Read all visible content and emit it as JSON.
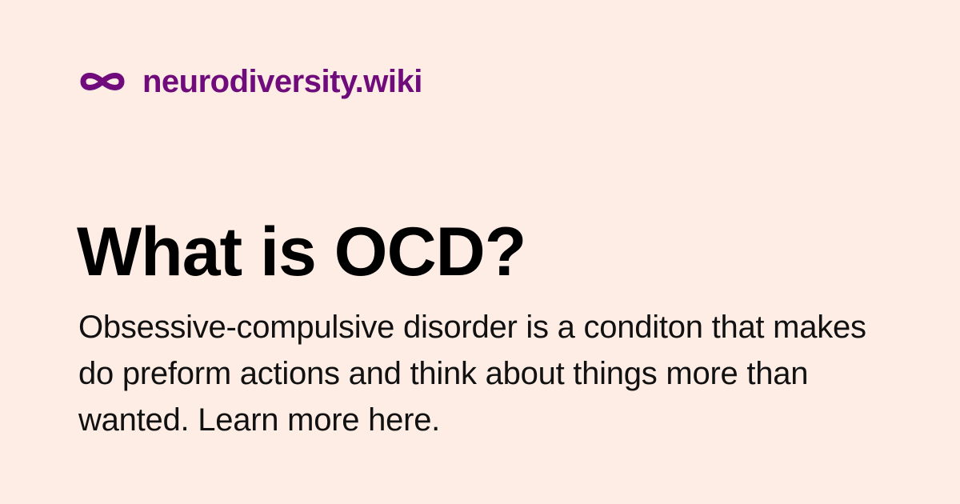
{
  "brand": {
    "icon": "infinity-logo-icon",
    "name": "neurodiversity.wiki",
    "color": "#6f0b7a"
  },
  "hero": {
    "title": "What is OCD?",
    "description": "Obsessive-compulsive disorder is a conditon that makes do preform actions and think about things more than wanted. Learn more here."
  },
  "colors": {
    "background": "#fdede5",
    "text": "#111111"
  }
}
